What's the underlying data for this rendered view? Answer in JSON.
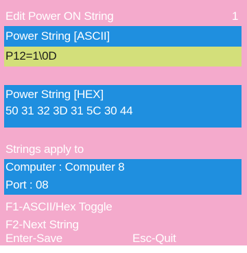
{
  "title": "Edit Power ON String",
  "page_number": "1",
  "ascii_section": {
    "label": "Power String [ASCII]",
    "value": "P12=1\\0D"
  },
  "hex_section": {
    "label": "Power String  [HEX]",
    "value": "50 31 32 3D 31 5C 30 44"
  },
  "apply_section": {
    "label": "Strings apply to",
    "computer": "Computer  :  Computer 8",
    "port": "Port : 08"
  },
  "keys": {
    "f1": "F1-ASCII/Hex Toggle",
    "f2": "F2-Next String",
    "enter": "Enter-Save",
    "esc": "Esc-Quit"
  },
  "colors": {
    "background": "#f4aacc",
    "highlight_blue": "#1f8fdf",
    "edit_field": "#d3df7a",
    "text": "#ffffff"
  }
}
